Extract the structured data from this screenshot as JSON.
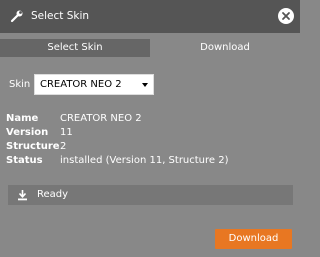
{
  "window": {
    "title": "Select Skin",
    "app_icon": "wrench-icon",
    "close_icon": "close-icon"
  },
  "tabs": [
    {
      "label": "Select Skin",
      "active": false
    },
    {
      "label": "Download",
      "active": true
    }
  ],
  "skin_selector": {
    "label": "Skin",
    "selected": "CREATOR NEO 2",
    "arrow_icon": "dropdown-arrow-icon"
  },
  "info": {
    "name_label": "Name",
    "name_value": "CREATOR NEO 2",
    "version_label": "Version",
    "version_value": "11",
    "structure_label": "Structure",
    "structure_value": "2",
    "status_label": "Status",
    "status_value": "installed (Version 11, Structure 2)"
  },
  "status_bar": {
    "icon": "download-icon",
    "text": "Ready"
  },
  "actions": {
    "download_label": "Download"
  },
  "colors": {
    "titlebar": "#555555",
    "body": "#888888",
    "accent": "#e87722"
  }
}
